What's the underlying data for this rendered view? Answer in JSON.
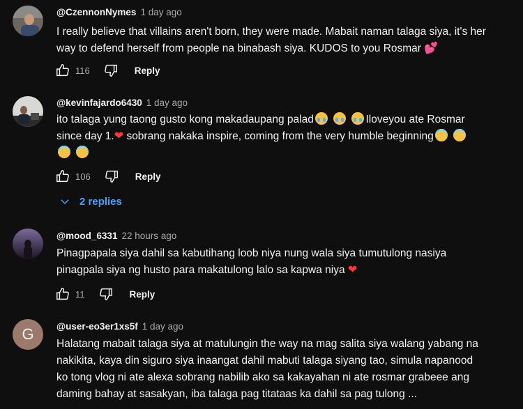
{
  "comments": [
    {
      "author": "@CzennonNymes",
      "time": "1 day ago",
      "text": "I really believe that villains aren't born, they were made. Mabait naman talaga siya, it's her way to defend herself from people na binabash siya. KUDOS to you Rosmar",
      "likes": "116",
      "reply_label": "Reply"
    },
    {
      "author": "@kevinfajardo6430",
      "time": "1 day ago",
      "text1": "ito talaga yung taong gusto kong makadaupang palad",
      "text2": "Iloveyou ate Rosmar",
      "text3": "since day 1.",
      "text4": "sobrang nakaka inspire, coming from the very humble beginning",
      "likes": "106",
      "reply_label": "Reply",
      "replies_label": "2 replies"
    },
    {
      "author": "@mood_6331",
      "time": "22 hours ago",
      "text": "Pinagpapala siya dahil sa kabutihang loob niya nung wala siya tumutulong nasiya pinagpala siya ng husto para makatulong lalo sa kapwa niya",
      "likes": "11",
      "reply_label": "Reply"
    },
    {
      "author": "@user-eo3er1xs5f",
      "time": "1 day ago",
      "avatar_letter": "G",
      "text": "Halatang mabait talaga siya at matulungin the way na mag salita siya walang yabang na nakikita, kaya din siguro siya inaangat dahil mabuti talaga siyang tao, simula napanood ko tong vlog ni ate alexa sobrang nabilib ako sa kakayahan ni ate rosmar grabeee ang daming bahay at sasakyan, iba talaga pag titataas ka dahil sa pag tulong ..."
    }
  ],
  "colors": {
    "background": "#0f0f0f",
    "link": "#3ea6ff",
    "avatar4": "#9c7a6b"
  }
}
